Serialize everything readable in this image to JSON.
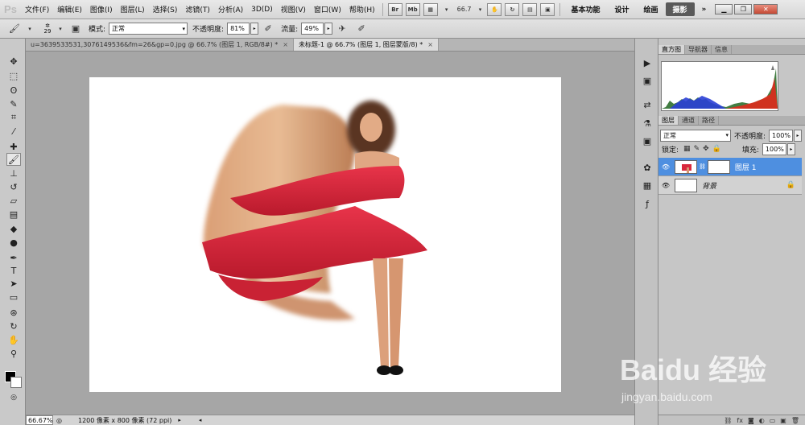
{
  "app": {
    "logo": "Ps"
  },
  "menu": [
    "文件(F)",
    "编辑(E)",
    "图像(I)",
    "图层(L)",
    "选择(S)",
    "滤镜(T)",
    "分析(A)",
    "3D(D)",
    "视图(V)",
    "窗口(W)",
    "帮助(H)"
  ],
  "menubar_buttons": {
    "br": "Br",
    "mb": "Mb",
    "zoom": "66.7"
  },
  "workspaces": {
    "essentials": "基本功能",
    "design": "设计",
    "painting": "绘画",
    "photography": "摄影",
    "more": "»"
  },
  "options": {
    "brush_size": "29",
    "mode_label": "模式:",
    "mode_value": "正常",
    "opacity_label": "不透明度:",
    "opacity_value": "81%",
    "flow_label": "流量:",
    "flow_value": "49%"
  },
  "tabs": [
    {
      "title": "u=3639533531,3076149536&fm=26&gp=0.jpg @ 66.7% (图层 1, RGB/8#) *",
      "close": "×"
    },
    {
      "title": "未标题-1 @ 66.7% (图层 1, 图层蒙版/8) *",
      "close": "×"
    }
  ],
  "status": {
    "zoom": "66.67%",
    "doc_size": "1200 像素 x 800 像素 (72 ppi)"
  },
  "panels": {
    "histogram_tabs": [
      "直方图",
      "导航器",
      "信息"
    ],
    "layers_tabs": [
      "图层",
      "通道",
      "路径"
    ],
    "blend_mode": "正常",
    "opacity_label": "不透明度:",
    "opacity_value": "100%",
    "lock_label": "锁定:",
    "fill_label": "填充:",
    "fill_value": "100%",
    "layers": [
      {
        "name": "图层 1",
        "selected": true
      },
      {
        "name": "背景",
        "selected": false
      }
    ]
  },
  "watermark": {
    "logo": "Baidu 经验",
    "url": "jingyan.baidu.com"
  },
  "colors": {
    "accent": "#4e8fe0",
    "dress": "#d8283c"
  }
}
